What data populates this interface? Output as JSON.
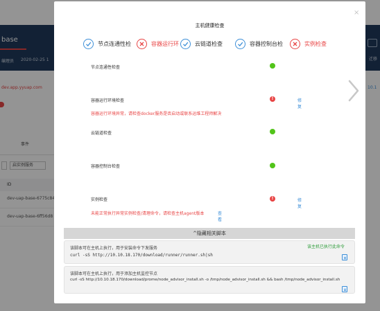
{
  "background": {
    "title": "base",
    "sub1": "编理员",
    "sub2": "2020-02-25 1",
    "right_label": "迁移",
    "link": "dev.app.yyuap.com",
    "link_right": "10.1",
    "tab": "事件",
    "button2": "启实例服务",
    "table_header": "ID",
    "rows": [
      "dev-uap-base-6775c84",
      "dev-uap-base-6ff56d8"
    ]
  },
  "modal": {
    "title": "主机健康检查",
    "steps": [
      {
        "label": "节点连通性检",
        "status": "ok"
      },
      {
        "label": "容器运行环",
        "status": "error"
      },
      {
        "label": "云链道检查",
        "status": "ok"
      },
      {
        "label": "容器控制台检",
        "status": "ok"
      },
      {
        "label": "实例检查",
        "status": "error"
      }
    ],
    "checks": [
      {
        "name": "节点连通性检查",
        "status": "ok"
      },
      {
        "name": "容器运行环境检查",
        "status": "error",
        "fix": "修复",
        "message": "容器运行环境异常，请检查docker服务是否启动或联系运维工程师解决"
      },
      {
        "name": "云链道检查",
        "status": "ok"
      },
      {
        "name": "容器控制台检查",
        "status": "ok"
      },
      {
        "name": "实例检查",
        "status": "error",
        "fix": "修复",
        "message": "未能正常执行异常实例检查/清理命令，请检查主机agent版本",
        "view": "查看"
      }
    ],
    "scripts_toggle": "^隐藏相关脚本",
    "scripts": [
      {
        "desc": "该脚本可在主机上执行，用于安装命令下发服务",
        "cmd": "curl -sS http://10.10.18.170/download/runner/runner.sh|sh",
        "done": "该主机已执行此命令"
      },
      {
        "desc": "该脚本可在主机上执行，用于添加主机监控节点",
        "cmd": "curl -sS http://10.10.18.170/download/prome/node_advisor_install.sh -o /tmp/node_advisor_install.sh && bash /tmp/node_advisor_install.sh"
      }
    ]
  },
  "colors": {
    "primary": "#3d8fd8",
    "error": "#e84545",
    "success": "#52c41a",
    "header": "#1f3a5c"
  }
}
